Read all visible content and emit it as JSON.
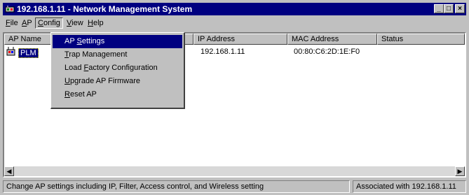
{
  "window": {
    "title": "192.168.1.11 - Network Management System",
    "buttons": {
      "minimize": "_",
      "maximize": "□",
      "close": "×"
    }
  },
  "menubar": [
    {
      "label": "File",
      "accel": "F",
      "rest": "ile"
    },
    {
      "label": "AP",
      "accel": "A",
      "rest": "P"
    },
    {
      "label": "Config",
      "accel": "C",
      "rest": "onfig"
    },
    {
      "label": "View",
      "accel": "V",
      "rest": "iew"
    },
    {
      "label": "Help",
      "accel": "H",
      "rest": "elp"
    }
  ],
  "config_menu": [
    {
      "pre": "AP ",
      "accel": "S",
      "post": "ettings"
    },
    {
      "pre": "",
      "accel": "T",
      "post": "rap Management"
    },
    {
      "pre": "Load ",
      "accel": "F",
      "post": "actory Configuration"
    },
    {
      "pre": "",
      "accel": "U",
      "post": "pgrade AP Firmware"
    },
    {
      "pre": "",
      "accel": "R",
      "post": "eset AP"
    }
  ],
  "list": {
    "columns": [
      "AP Name",
      "IP Address",
      "MAC Address",
      "Status"
    ],
    "rows": [
      {
        "ap_name": "PLM",
        "ip": "192.168.1.11",
        "mac": "00:80:C6:2D:1E:F0",
        "status": ""
      }
    ]
  },
  "statusbar": {
    "message": "Change AP settings including IP, Filter, Access control, and Wireless setting",
    "association": "Associated with 192.168.1.11"
  },
  "colors": {
    "titlebar": "#000080",
    "selection": "#000080",
    "face": "#c0c0c0"
  },
  "icons": [
    "network-app-icon",
    "ap-device-icon",
    "scroll-left-icon",
    "scroll-right-icon"
  ]
}
